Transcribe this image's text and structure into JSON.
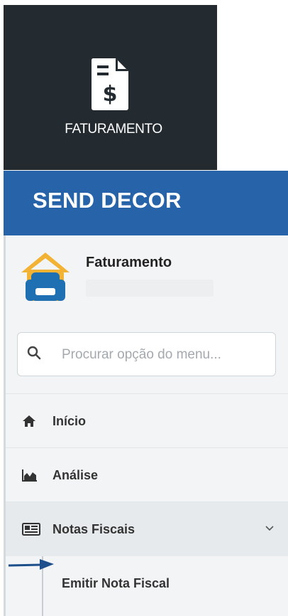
{
  "tile": {
    "label": "FATURAMENTO",
    "icon": "invoice-dollar-icon"
  },
  "header": {
    "brand": "SEND DECOR"
  },
  "profile": {
    "name": "Faturamento",
    "avatar_icon": "sofa-house-icon"
  },
  "search": {
    "placeholder": "Procurar opção do menu...",
    "icon": "search-icon"
  },
  "menu": {
    "items": [
      {
        "label": "Início",
        "icon": "home-icon"
      },
      {
        "label": "Análise",
        "icon": "area-chart-icon"
      },
      {
        "label": "Notas Fiscais",
        "icon": "newspaper-icon",
        "expanded": true
      }
    ],
    "submenu": [
      {
        "label": "Emitir Nota Fiscal"
      }
    ]
  },
  "colors": {
    "tile_bg": "#232b30",
    "header_bg": "#2763a8",
    "sidebar_bg": "#f3f4f5",
    "avatar_roof": "#f2b233",
    "avatar_sofa": "#1f6fb3",
    "arrow": "#1c4f8c"
  }
}
